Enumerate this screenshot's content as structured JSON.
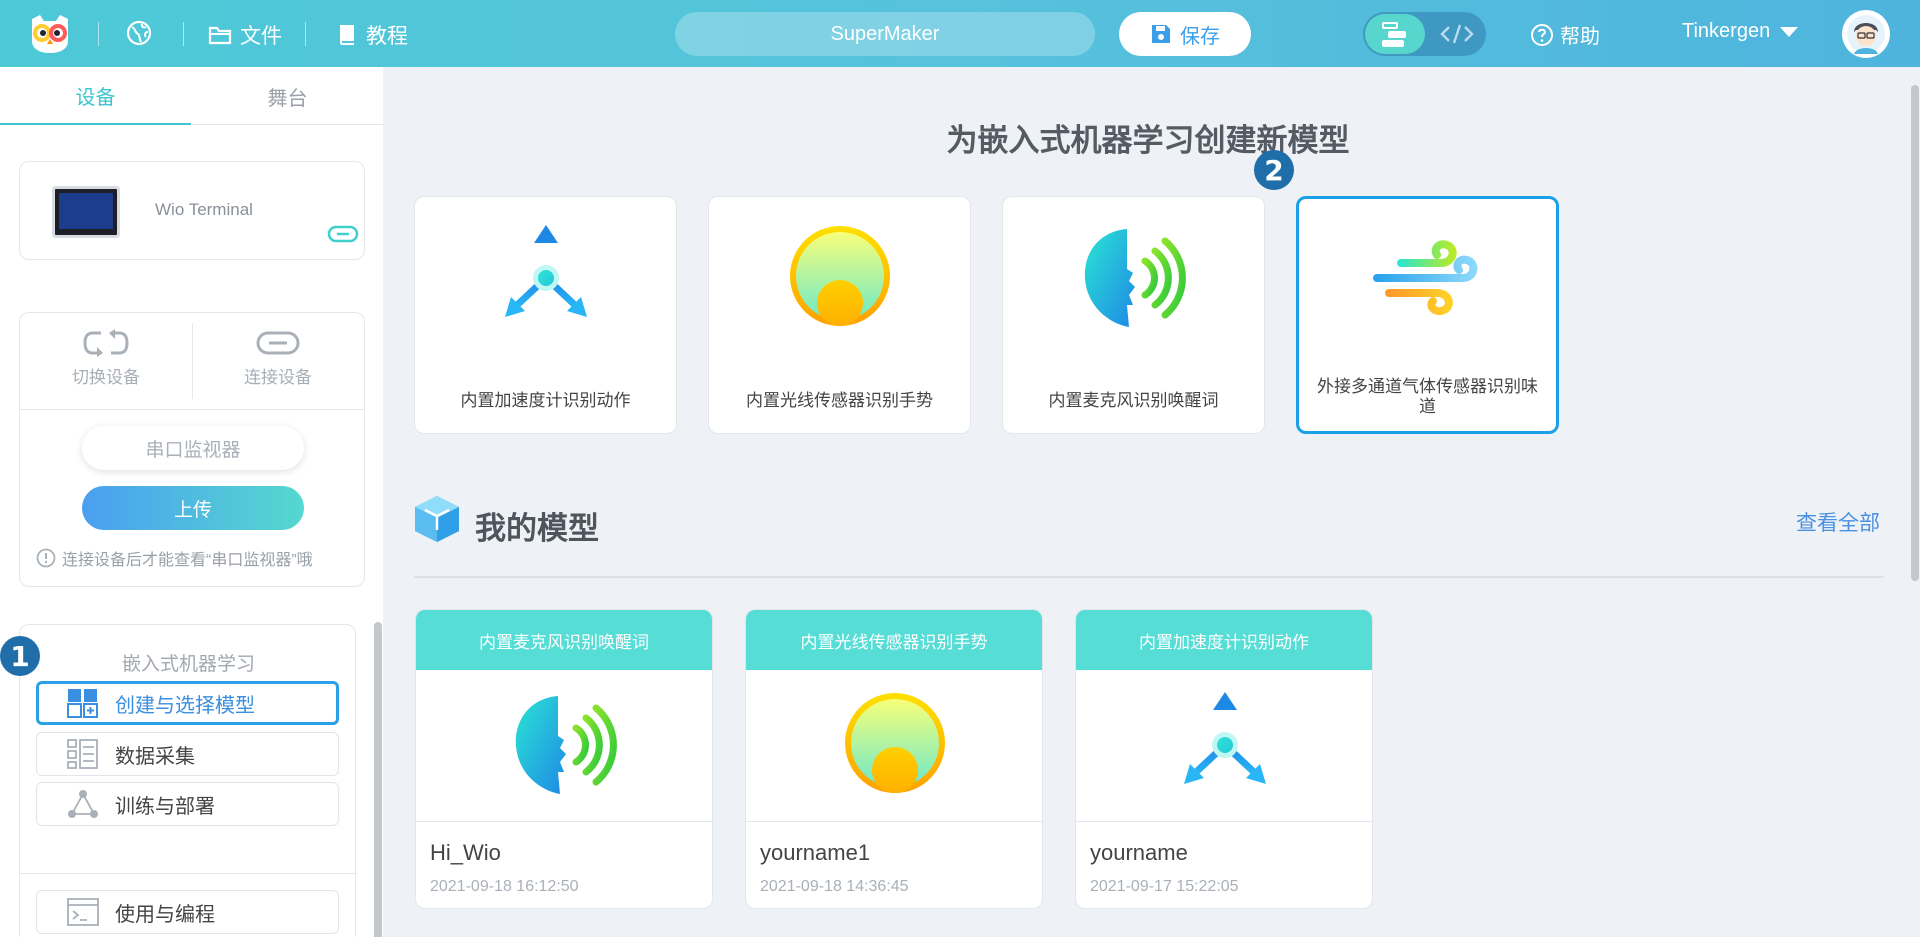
{
  "topbar": {
    "file_label": "文件",
    "tutorial_label": "教程",
    "project_name": "SuperMaker",
    "save_label": "保存",
    "help_label": "帮助",
    "username": "Tinkergen"
  },
  "sidebar": {
    "tabs": [
      {
        "label": "设备",
        "active": true
      },
      {
        "label": "舞台",
        "active": false
      }
    ],
    "device": {
      "name": "Wio Terminal"
    },
    "ops": {
      "switch_label": "切换设备",
      "connect_label": "连接设备",
      "serial_label": "串口监视器",
      "upload_label": "上传",
      "note": "连接设备后才能查看“串口监视器”哦"
    },
    "ml": {
      "title": "嵌入式机器学习",
      "items": [
        {
          "label": "创建与选择模型",
          "active": true
        },
        {
          "label": "数据采集"
        },
        {
          "label": "训练与部署"
        },
        {
          "label": "使用与编程"
        }
      ]
    }
  },
  "badges": [
    "1",
    "2"
  ],
  "main": {
    "title": "为嵌入式机器学习创建新模型",
    "templates": [
      {
        "label": "内置加速度计识别动作",
        "icon": "accelerometer-icon"
      },
      {
        "label": "内置光线传感器识别手势",
        "icon": "light-sensor-icon"
      },
      {
        "label": "内置麦克风识别唤醒词",
        "icon": "microphone-voice-icon"
      },
      {
        "label": "外接多通道气体传感器识别味道",
        "icon": "gas-sensor-icon",
        "selected": true
      }
    ],
    "my_models_title": "我的模型",
    "view_all": "查看全部",
    "models": [
      {
        "type": "内置麦克风识别唤醒词",
        "name": "Hi_Wio",
        "date": "2021-09-18 16:12:50"
      },
      {
        "type": "内置光线传感器识别手势",
        "name": "yourname1",
        "date": "2021-09-18 14:36:45"
      },
      {
        "type": "内置加速度计识别动作",
        "name": "yourname",
        "date": "2021-09-17 15:22:05"
      }
    ]
  },
  "colors": {
    "accent": "#3fc6d0",
    "selected_border": "#1aa0e6",
    "model_header": "#56ddd6",
    "badge": "#1f6eaa"
  }
}
